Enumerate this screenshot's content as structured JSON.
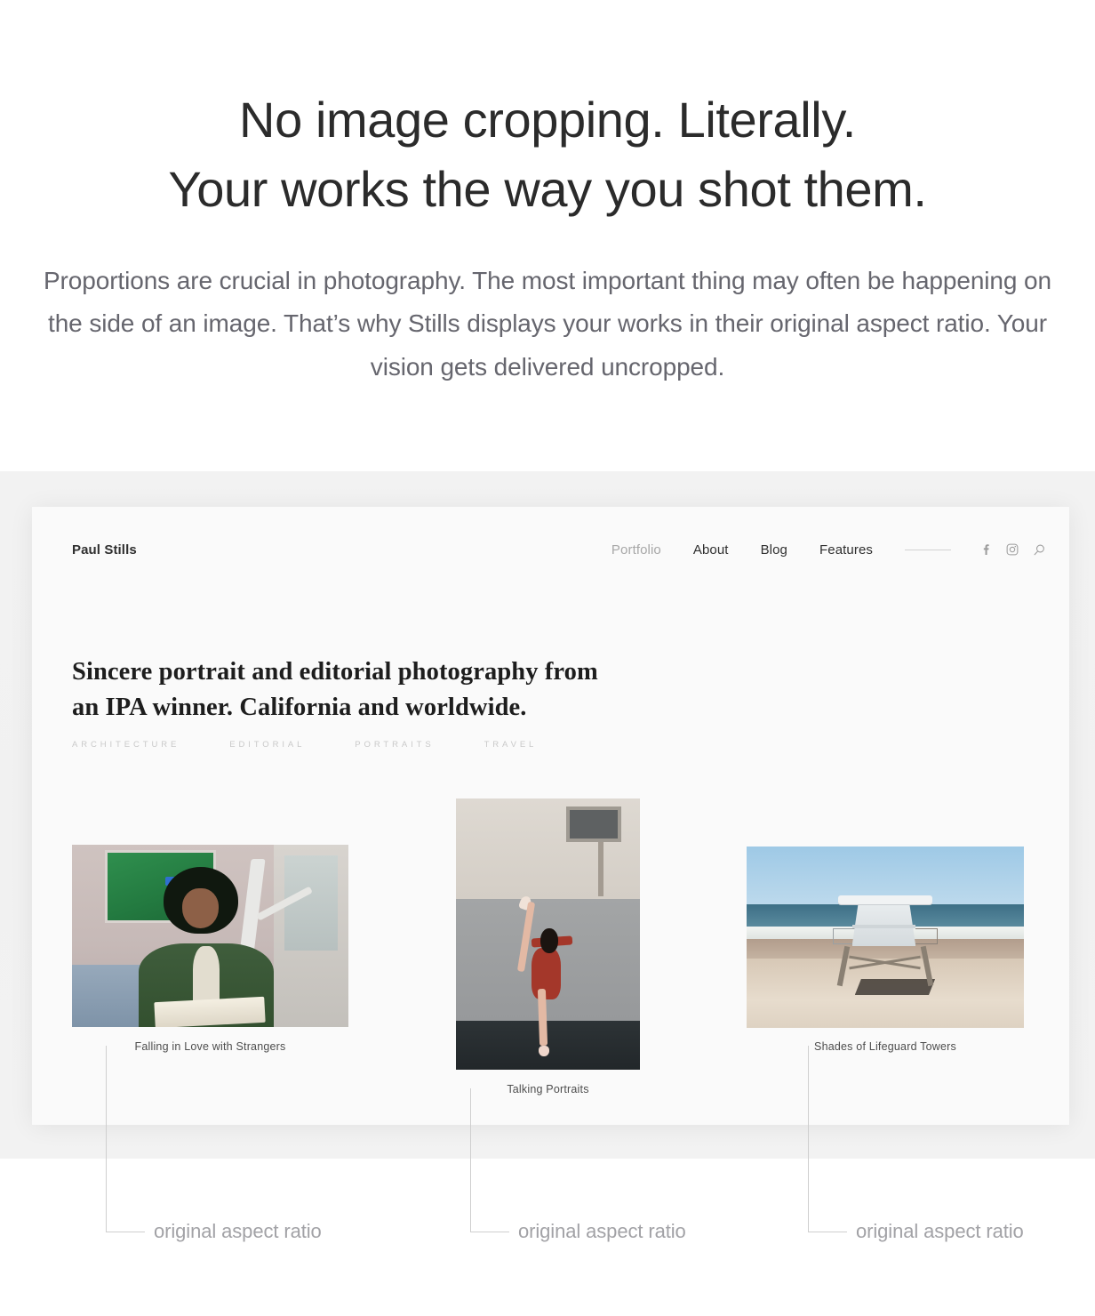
{
  "intro": {
    "headline_line1": "No image cropping. Literally.",
    "headline_line2": "Your works the way you shot them.",
    "subcopy_line1": "Proportions are crucial in photography. The most important thing may often",
    "subcopy_line2": "be happening on the side of an image. That’s why Stills displays your works",
    "subcopy_line3": "in their original aspect ratio. Your vision gets delivered uncropped."
  },
  "site": {
    "brand": "Paul Stills",
    "nav": [
      {
        "label": "Portfolio",
        "muted": true
      },
      {
        "label": "About",
        "muted": false
      },
      {
        "label": "Blog",
        "muted": false
      },
      {
        "label": "Features",
        "muted": false
      }
    ],
    "icons": {
      "facebook": "facebook-icon",
      "instagram": "instagram-icon",
      "search": "search-icon"
    },
    "hero_line1": "Sincere portrait and editorial photography from",
    "hero_line2": "an IPA winner. California and worldwide.",
    "categories": [
      "ARCHITECTURE",
      "EDITORIAL",
      "PORTRAITS",
      "TRAVEL"
    ],
    "gallery": [
      {
        "caption": "Falling in Love with Strangers",
        "orientation": "landscape"
      },
      {
        "caption": "Talking Portraits",
        "orientation": "portrait"
      },
      {
        "caption": "Shades of Lifeguard Towers",
        "orientation": "landscape"
      }
    ]
  },
  "annotations": {
    "label_1": "original aspect ratio",
    "label_2": "original aspect ratio",
    "label_3": "original aspect ratio"
  },
  "colors": {
    "page_background": "#ffffff",
    "band_background": "#f2f2f2",
    "card_background": "#fafafa",
    "headline_text": "#2b2b2b",
    "subcopy_text": "#66666e",
    "annotation_text": "#a2a2a6",
    "leader_line": "#cfcfcf",
    "category_text": "#c9c9c9",
    "nav_muted": "#a7a7a7"
  }
}
